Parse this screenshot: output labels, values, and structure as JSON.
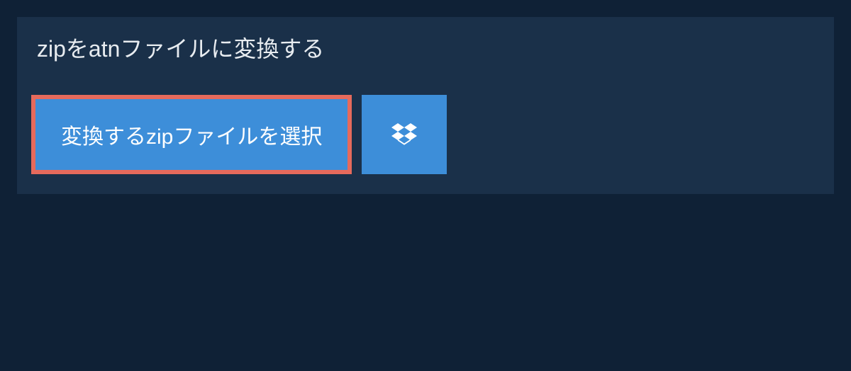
{
  "header": {
    "title": "zipをatnファイルに変換する"
  },
  "actions": {
    "select_file_label": "変換するzipファイルを選択"
  },
  "colors": {
    "page_bg": "#0f2136",
    "panel_bg": "#1a3049",
    "button_bg": "#3d8ed9",
    "button_border": "#e66a5c",
    "text": "#e8ecf0"
  }
}
